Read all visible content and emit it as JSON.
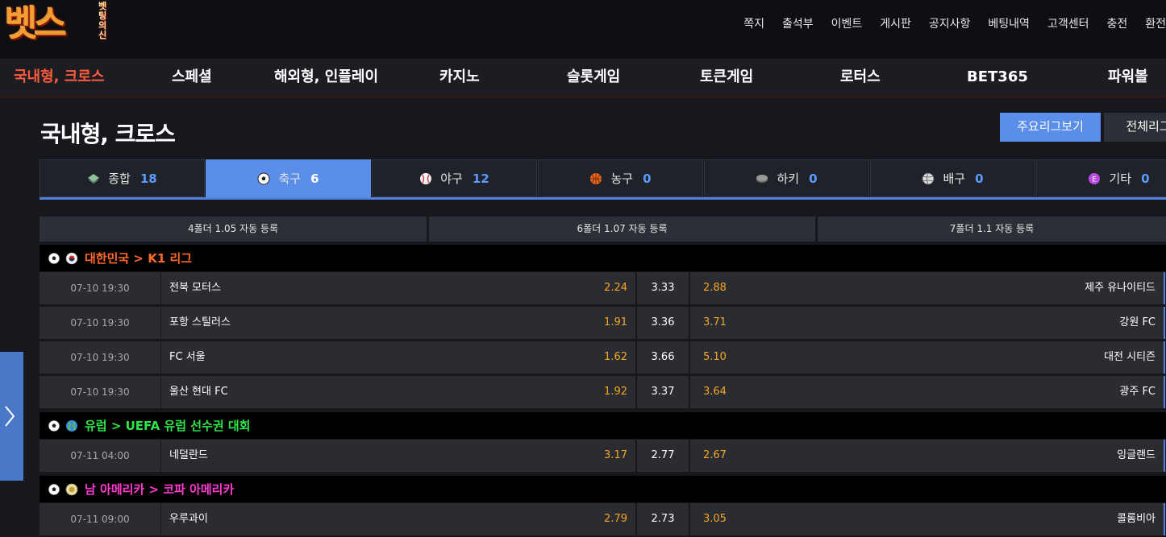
{
  "header": {
    "logo_main": "벳스",
    "logo_sub": "벳팅의신",
    "top_menu": [
      "쪽지",
      "출석부",
      "이벤트",
      "게시판",
      "공지사항",
      "베팅내역",
      "고객센터",
      "충전",
      "환전"
    ]
  },
  "nav": {
    "items": [
      "국내형, 크로스",
      "스페셜",
      "해외형, 인플레이",
      "카지노",
      "슬롯게임",
      "토큰게임",
      "로터스",
      "BET365",
      "파워볼"
    ],
    "active_index": 0
  },
  "page": {
    "title": "국내형, 크로스",
    "btn_major": "주요리그보기",
    "btn_all": "전체리그"
  },
  "sport_tabs": [
    {
      "label": "종합",
      "count": "18",
      "icon": "layers-icon"
    },
    {
      "label": "축구",
      "count": "6",
      "icon": "soccer-ball-icon",
      "active": true
    },
    {
      "label": "야구",
      "count": "12",
      "icon": "baseball-icon"
    },
    {
      "label": "농구",
      "count": "0",
      "icon": "basketball-icon"
    },
    {
      "label": "하키",
      "count": "0",
      "icon": "hockey-puck-icon"
    },
    {
      "label": "배구",
      "count": "0",
      "icon": "volleyball-icon"
    },
    {
      "label": "기타",
      "count": "0",
      "icon": "etc-icon"
    }
  ],
  "folders": [
    "4폴더 1.05 자동 등록",
    "6폴더 1.07 자동 등록",
    "7폴더 1.1 자동 등록"
  ],
  "leagues": [
    {
      "name": "대한민국 > K1 리그",
      "color": "#ff6a2a",
      "flag_icon": "korea-flag-icon",
      "matches": [
        {
          "time": "07-10 19:30",
          "home": "전북 모터스",
          "home_odd": "2.24",
          "draw": "3.33",
          "away_odd": "2.88",
          "away": "제주 유나이티드"
        },
        {
          "time": "07-10 19:30",
          "home": "포항 스틸러스",
          "home_odd": "1.91",
          "draw": "3.36",
          "away_odd": "3.71",
          "away": "강원 FC"
        },
        {
          "time": "07-10 19:30",
          "home": "FC 서울",
          "home_odd": "1.62",
          "draw": "3.66",
          "away_odd": "5.10",
          "away": "대전 시티즌"
        },
        {
          "time": "07-10 19:30",
          "home": "울산 현대 FC",
          "home_odd": "1.92",
          "draw": "3.37",
          "away_odd": "3.64",
          "away": "광주 FC"
        }
      ]
    },
    {
      "name": "유럽 > UEFA 유럽 선수권 대회",
      "color": "#2ee54a",
      "flag_icon": "globe-icon",
      "matches": [
        {
          "time": "07-11 04:00",
          "home": "네덜란드",
          "home_odd": "3.17",
          "draw": "2.77",
          "away_odd": "2.67",
          "away": "잉글랜드"
        }
      ]
    },
    {
      "name": "남 아메리카 > 코파 아메리카",
      "color": "#ff3ad0",
      "flag_icon": "copa-america-icon",
      "matches": [
        {
          "time": "07-11 09:00",
          "home": "우루과이",
          "home_odd": "2.79",
          "draw": "2.73",
          "away_odd": "3.05",
          "away": "콜롬비아"
        }
      ]
    }
  ]
}
